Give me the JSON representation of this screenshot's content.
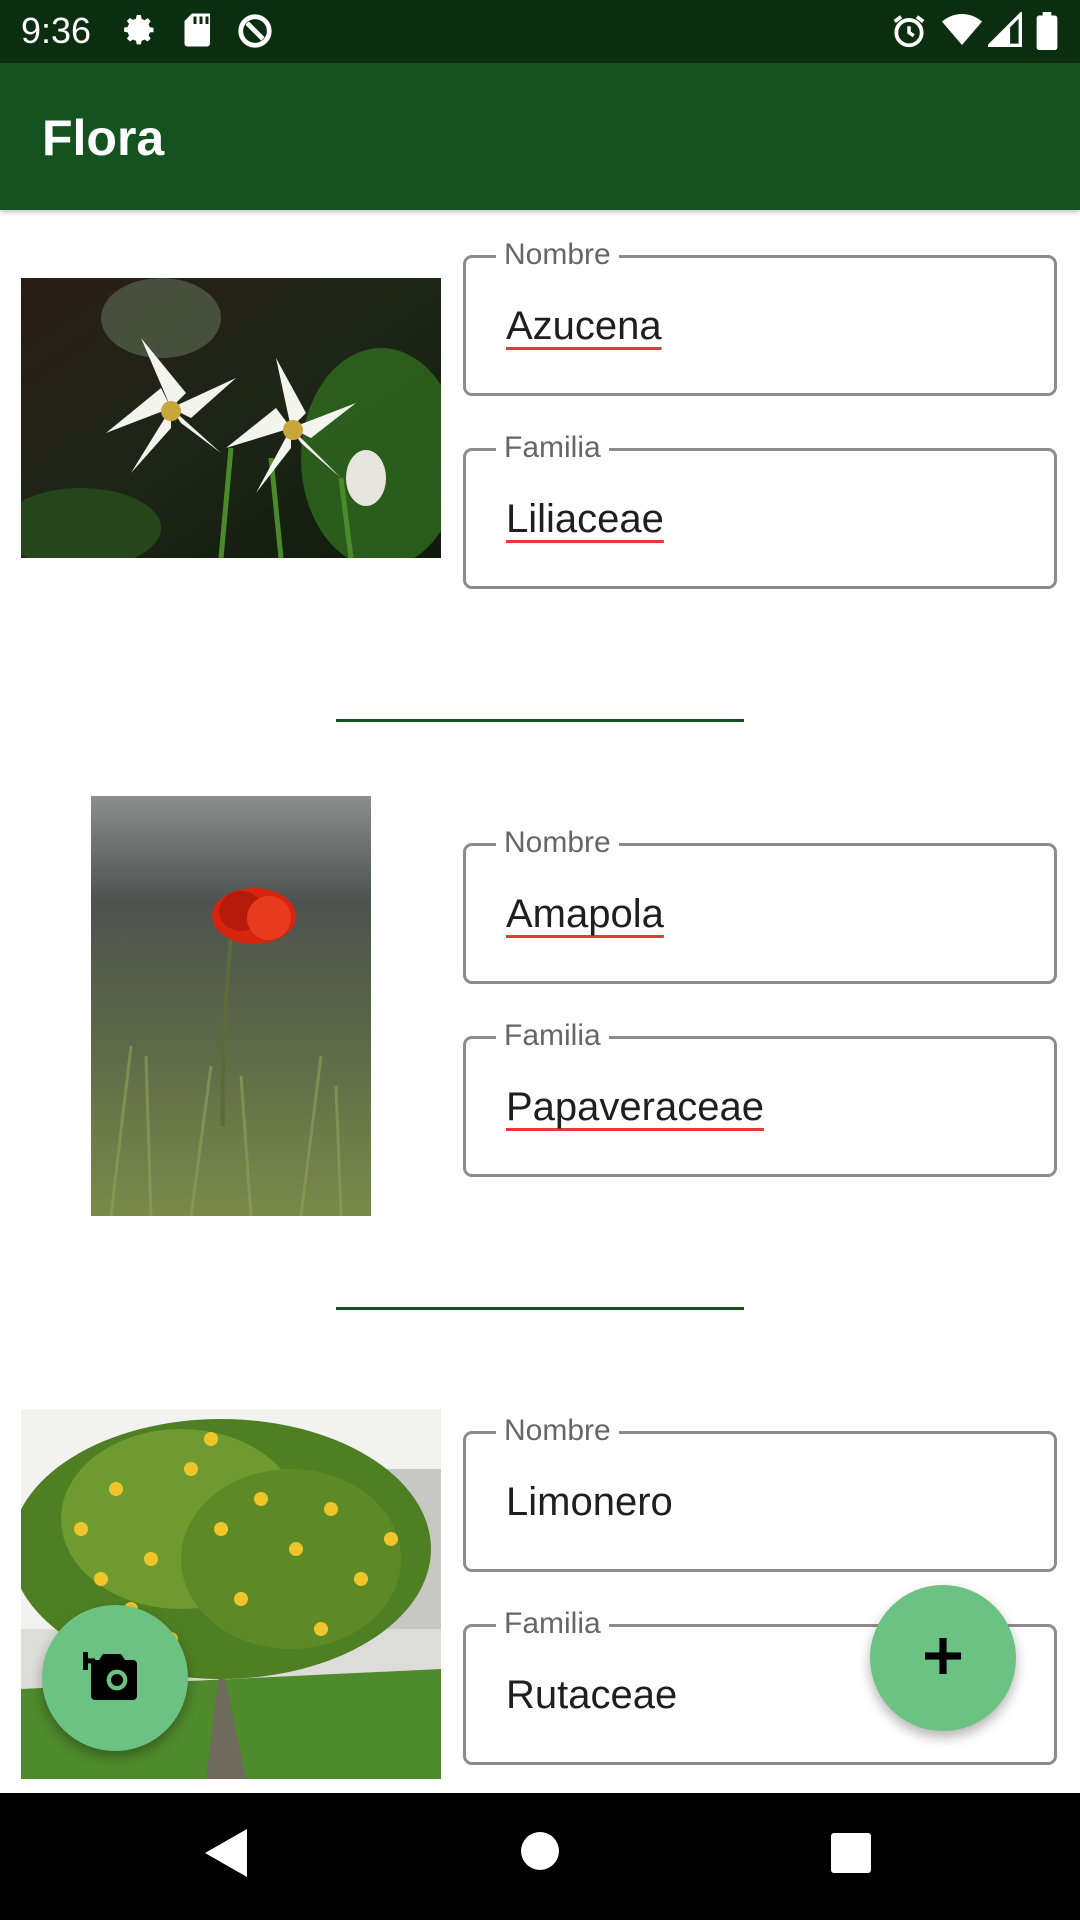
{
  "status_bar": {
    "time": "9:36",
    "icons": [
      "settings-gear-icon",
      "sd-card-icon",
      "data-saver-icon",
      "alarm-icon",
      "wifi-icon",
      "cell-signal-icon",
      "battery-icon"
    ]
  },
  "app_bar": {
    "title": "Flora"
  },
  "plants": [
    {
      "name_label": "Nombre",
      "name": "Azucena",
      "family_label": "Familia",
      "family": "Liliaceae",
      "photo": "white-lily-photo"
    },
    {
      "name_label": "Nombre",
      "name": "Amapola",
      "family_label": "Familia",
      "family": "Papaveraceae",
      "photo": "red-poppy-photo"
    },
    {
      "name_label": "Nombre",
      "name": "Limonero",
      "family_label": "Familia",
      "family": "Rutaceae",
      "photo": "lemon-tree-photo"
    }
  ],
  "fabs": {
    "add_photo": {
      "icon": "add-photo-camera-icon"
    },
    "add": {
      "icon": "plus-icon"
    }
  },
  "colors": {
    "status_bar": "#0a2e0f",
    "app_bar": "#145220",
    "divider": "#145220",
    "fab": "#6cc283",
    "spellcheck_underline": "#e53935"
  },
  "nav_bar": {
    "buttons": [
      "back-icon",
      "home-icon",
      "recents-icon"
    ]
  }
}
